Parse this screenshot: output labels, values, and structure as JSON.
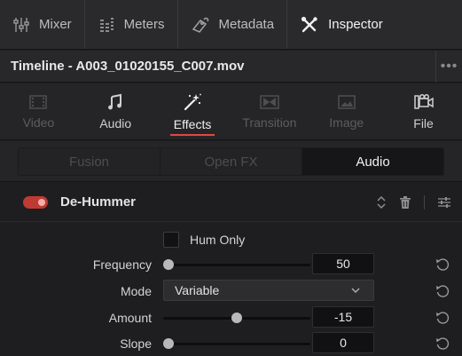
{
  "toolbar": {
    "items": [
      {
        "label": "Mixer",
        "icon": "mixer-icon"
      },
      {
        "label": "Meters",
        "icon": "meters-icon"
      },
      {
        "label": "Metadata",
        "icon": "metadata-icon"
      },
      {
        "label": "Inspector",
        "icon": "inspector-icon",
        "active": true
      }
    ]
  },
  "titlebar": {
    "title": "Timeline - A003_01020155_C007.mov",
    "more": "•••"
  },
  "categories": [
    {
      "label": "Video",
      "icon": "video-icon",
      "enabled": false
    },
    {
      "label": "Audio",
      "icon": "music-note-icon",
      "enabled": true
    },
    {
      "label": "Effects",
      "icon": "magic-wand-icon",
      "enabled": true,
      "active": true
    },
    {
      "label": "Transition",
      "icon": "transition-icon",
      "enabled": false
    },
    {
      "label": "Image",
      "icon": "image-icon",
      "enabled": false
    },
    {
      "label": "File",
      "icon": "file-camera-icon",
      "enabled": true
    }
  ],
  "subtabs": [
    {
      "label": "Fusion",
      "active": false
    },
    {
      "label": "Open FX",
      "active": false
    },
    {
      "label": "Audio",
      "active": true
    }
  ],
  "effect": {
    "name": "De-Hummer",
    "enabled": true,
    "accent": "#e2483f",
    "hum_only_label": "Hum Only",
    "hum_only_checked": false,
    "params": {
      "frequency": {
        "label": "Frequency",
        "value": "50",
        "slider_fraction": 0.0
      },
      "mode": {
        "label": "Mode",
        "value": "Variable"
      },
      "amount": {
        "label": "Amount",
        "value": "-15",
        "slider_fraction": 0.5
      },
      "slope": {
        "label": "Slope",
        "value": "0",
        "slider_fraction": 0.0
      }
    }
  }
}
